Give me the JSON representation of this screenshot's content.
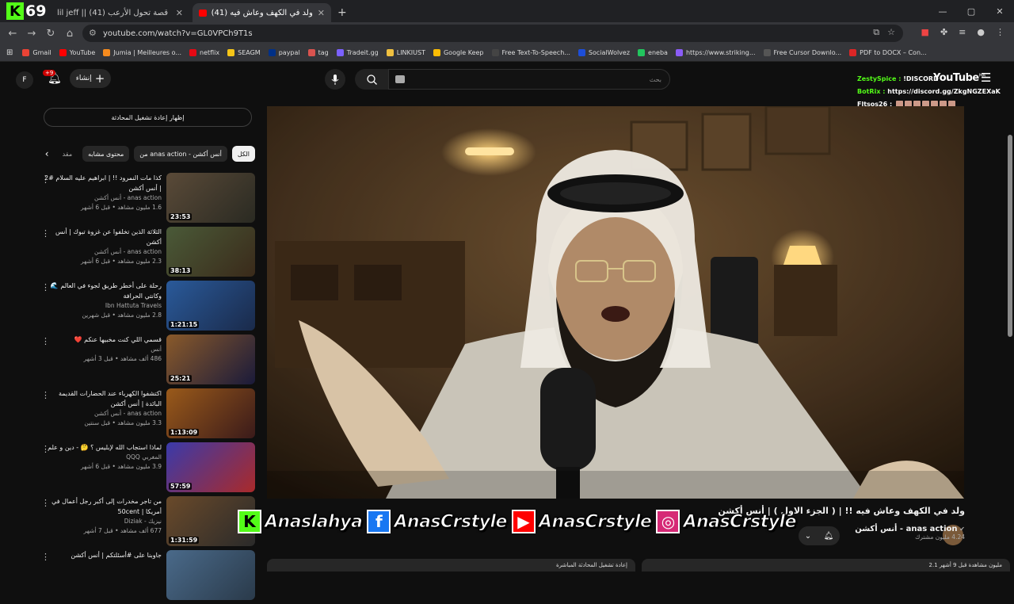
{
  "overlay": {
    "k_logo": "K",
    "k_number": "69"
  },
  "browser": {
    "tabs": [
      {
        "title": "lil jeff || (41) قصة تحول الأرعب",
        "close": "✕"
      },
      {
        "title": "(41) ولد في الكهف وعاش فيه",
        "close": "✕"
      }
    ],
    "new_tab": "+",
    "window": {
      "min": "—",
      "max": "▢",
      "close": "✕"
    },
    "url": "youtube.com/watch?v=GL0VPCh9T1s",
    "bookmarks": [
      {
        "label": "Gmail",
        "color": "#ea4335"
      },
      {
        "label": "YouTube",
        "color": "#ff0000"
      },
      {
        "label": "Jumia | Meilleures o...",
        "color": "#f68b1e"
      },
      {
        "label": "netflix",
        "color": "#e50914"
      },
      {
        "label": "SEAGM",
        "color": "#f5c518"
      },
      {
        "label": "paypal",
        "color": "#003087"
      },
      {
        "label": "tag",
        "color": "#d9534f"
      },
      {
        "label": "Tradeit.gg",
        "color": "#7b61ff"
      },
      {
        "label": "LINKIUST",
        "color": "#f0c040"
      },
      {
        "label": "Google Keep",
        "color": "#fbbc04"
      },
      {
        "label": "Free Text-To-Speech...",
        "color": "#444444"
      },
      {
        "label": "SocialWolvez",
        "color": "#1d4ed8"
      },
      {
        "label": "eneba",
        "color": "#22c55e"
      },
      {
        "label": "https://www.striking...",
        "color": "#8b5cf6"
      },
      {
        "label": "Free Cursor Downlo...",
        "color": "#555555"
      },
      {
        "label": "PDF to DOCX – Con...",
        "color": "#dc2626"
      }
    ]
  },
  "youtube": {
    "avatar_letter": "F",
    "notification_count": "+9",
    "create_label": "إنشاء",
    "search_placeholder": "بحث",
    "logo": "YouTube",
    "logo_region": "MA",
    "chat": [
      {
        "name": "ZestySpice :",
        "text": "!DISCORD"
      },
      {
        "name": "BotRix :",
        "text": "https://discord.gg/ZkgNGZEXaK"
      },
      {
        "name": "Fltsos26 :",
        "text": ""
      }
    ],
    "replay_label": "إظهار إعادة تشغيل المحادثة",
    "chips": [
      "الكل",
      "من anas action - أنس أكشن",
      "محتوى مشابه",
      "مقد"
    ],
    "related": [
      {
        "title": "كذا مات النمرود !! | ابراهيم عليه السلام #2 | أنس أكشن",
        "channel": "anas action - أنس أكشن",
        "views": "1.6 مليون مشاهد • قبل 6 أشهر",
        "duration": "23:53",
        "c1": "#5a4a38",
        "c2": "#2a2a22"
      },
      {
        "title": "الثلاثة الذين تخلفوا عن غزوة تبوك | أنس أكشن",
        "channel": "anas action - أنس أكشن",
        "views": "2.3 مليون مشاهد • قبل 6 أشهر",
        "duration": "38:13",
        "c1": "#4a5a38",
        "c2": "#3a2a1a"
      },
      {
        "title": "رحلة على أخطر طريق لجوء في العالم 🌊 وكانتي الحرافة",
        "channel": "Ibn Hattuta Travels",
        "views": "2.8 مليون مشاهد • قبل شهرين",
        "duration": "1:21:15",
        "c1": "#2a5a9a",
        "c2": "#1a2a4a"
      },
      {
        "title": "قسمي اللي كنت مخبيها عنكم ❤️",
        "channel": "أنس",
        "views": "486 ألف مشاهد • قبل 3 أشهر",
        "duration": "25:21",
        "c1": "#8a5a2a",
        "c2": "#1a1a3a"
      },
      {
        "title": "اكتشفوا الكهرباء عند الحضارات القديمة البائدة | أنس أكشن",
        "channel": "anas action - أنس أكشن",
        "views": "3.3 مليون مشاهد • قبل سنتين",
        "duration": "1:13:09",
        "c1": "#9a5a1a",
        "c2": "#3a1a1a"
      },
      {
        "title": "لماذا استجاب الله لإبليس ؟ 🤔 - دين و علم",
        "channel": "المغربي QQQ",
        "views": "3.9 مليون مشاهد • قبل 6 أشهر",
        "duration": "57:59",
        "c1": "#3a3aaa",
        "c2": "#aa2a2a"
      },
      {
        "title": "من تاجر مخدرات إلى أكبر رجل أعمال في أمريكا | 50cent",
        "channel": "نيزيك - Diziak",
        "views": "677 ألف مشاهد • قبل 7 أشهر",
        "duration": "1:31:59",
        "c1": "#6a4a2a",
        "c2": "#2a2a2a"
      },
      {
        "title": "جاوبنا على #أسئلتكم | أنس أكشن",
        "channel": "",
        "views": "",
        "duration": "",
        "c1": "#4a6a8a",
        "c2": "#2a3a4a"
      }
    ],
    "video": {
      "title": "ولد في الكهف وعاش فيه !! | ( الجزء الاول ) | أنس أكشن",
      "channel": "anas action - أنس أكشن",
      "subscribers": "4.24 مليون مشترك"
    },
    "panels": [
      "إعادة تشغيل المحادثة المباشرة",
      "2.1 مليون مشاهدة قبل 9 أشهر"
    ]
  },
  "socials": [
    {
      "icon": "K",
      "handle": "Anaslahya",
      "color": "#53fc18",
      "fg": "#000000"
    },
    {
      "icon": "f",
      "handle": "AnasCrstyle",
      "color": "#1877f2",
      "fg": "#ffffff"
    },
    {
      "icon": "▶",
      "handle": "AnasCrstyle",
      "color": "#ff0000",
      "fg": "#ffffff"
    },
    {
      "icon": "◎",
      "handle": "AnasCrstyle",
      "color": "#d62976",
      "fg": "#ffffff"
    }
  ]
}
